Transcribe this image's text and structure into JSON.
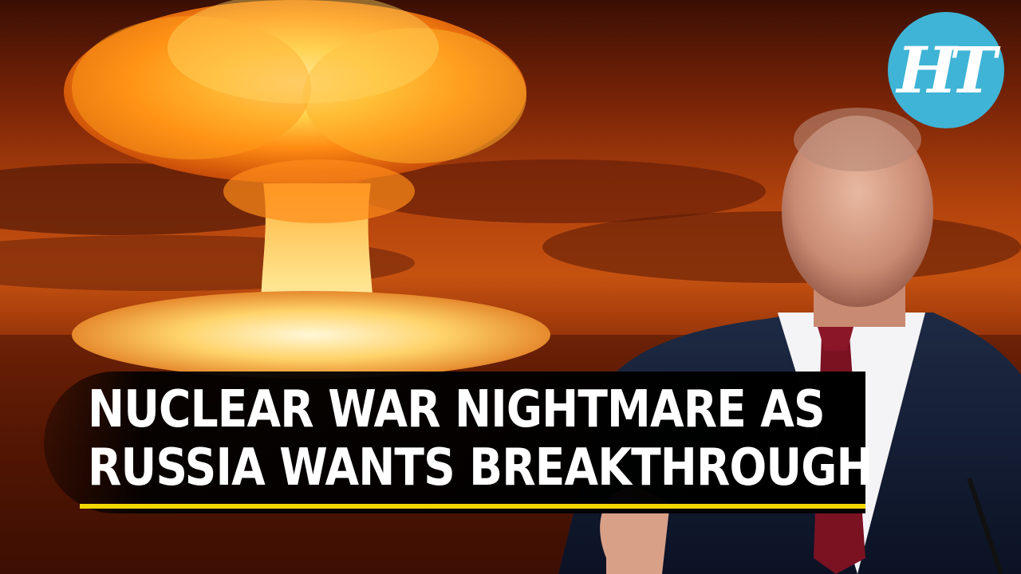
{
  "thumbnail": {
    "logo_text": "HT",
    "headline_lines": [
      "NUCLEAR WAR NIGHTMARE AS",
      "RUSSIA WANTS BREAKTHROUGH"
    ]
  },
  "colors": {
    "logo_bg": "#3fb4d6",
    "underline": "#f2d600",
    "fireball": "#ff9a1a"
  }
}
